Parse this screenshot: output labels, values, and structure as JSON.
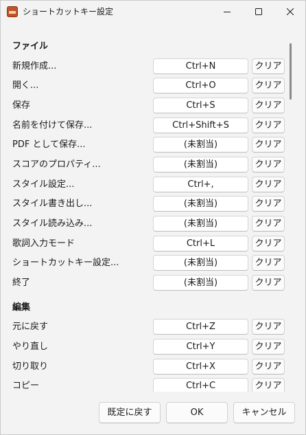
{
  "window": {
    "title": "ショートカットキー設定"
  },
  "sections": [
    {
      "header": "ファイル",
      "rows": [
        {
          "label": "新規作成...",
          "key": "Ctrl+N",
          "clear": "クリア"
        },
        {
          "label": "開く...",
          "key": "Ctrl+O",
          "clear": "クリア"
        },
        {
          "label": "保存",
          "key": "Ctrl+S",
          "clear": "クリア"
        },
        {
          "label": "名前を付けて保存...",
          "key": "Ctrl+Shift+S",
          "clear": "クリア"
        },
        {
          "label": "PDF として保存...",
          "key": "(未割当)",
          "clear": "クリア"
        },
        {
          "label": "スコアのプロパティ...",
          "key": "(未割当)",
          "clear": "クリア"
        },
        {
          "label": "スタイル設定...",
          "key": "Ctrl+,",
          "clear": "クリア"
        },
        {
          "label": "スタイル書き出し...",
          "key": "(未割当)",
          "clear": "クリア"
        },
        {
          "label": "スタイル読み込み...",
          "key": "(未割当)",
          "clear": "クリア"
        },
        {
          "label": "歌詞入力モード",
          "key": "Ctrl+L",
          "clear": "クリア"
        },
        {
          "label": "ショートカットキー設定...",
          "key": "(未割当)",
          "clear": "クリア"
        },
        {
          "label": "終了",
          "key": "(未割当)",
          "clear": "クリア"
        }
      ]
    },
    {
      "header": "編集",
      "rows": [
        {
          "label": "元に戻す",
          "key": "Ctrl+Z",
          "clear": "クリア"
        },
        {
          "label": "やり直し",
          "key": "Ctrl+Y",
          "clear": "クリア"
        },
        {
          "label": "切り取り",
          "key": "Ctrl+X",
          "clear": "クリア"
        },
        {
          "label": "コピー",
          "key": "Ctrl+C",
          "clear": "クリア"
        }
      ]
    }
  ],
  "footer": {
    "reset_label": "既定に戻す",
    "ok_label": "OK",
    "cancel_label": "キャンセル"
  }
}
